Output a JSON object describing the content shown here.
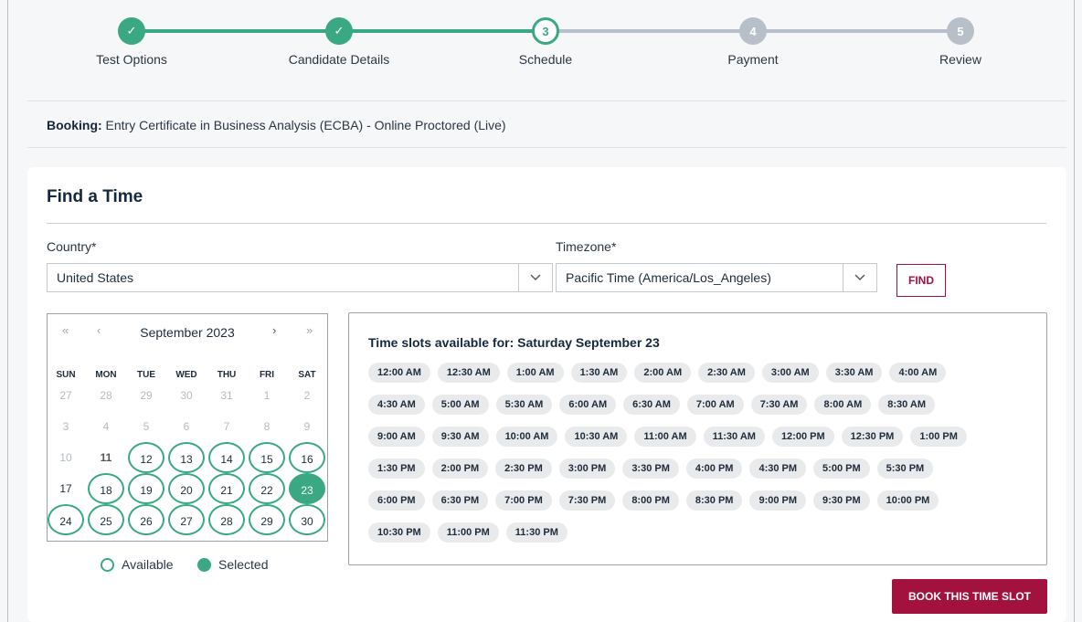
{
  "steps": [
    {
      "label": "Test Options",
      "state": "done",
      "mark": "✓"
    },
    {
      "label": "Candidate Details",
      "state": "done",
      "mark": "✓"
    },
    {
      "label": "Schedule",
      "state": "current",
      "mark": "3"
    },
    {
      "label": "Payment",
      "state": "todo",
      "mark": "4"
    },
    {
      "label": "Review",
      "state": "todo",
      "mark": "5"
    }
  ],
  "booking": {
    "prefix": "Booking:",
    "text": " Entry Certificate in Business Analysis (ECBA) - Online Proctored (Live)"
  },
  "card": {
    "title": "Find a Time"
  },
  "country": {
    "label": "Country*",
    "value": "United States"
  },
  "timezone": {
    "label": "Timezone*",
    "value": "Pacific Time (America/Los_Angeles)"
  },
  "find_label": "FIND",
  "calendar": {
    "month": "September 2023",
    "nav": {
      "prev_year": "«",
      "prev": "‹",
      "next": "›",
      "next_year": "»"
    },
    "dows": [
      "SUN",
      "MON",
      "TUE",
      "WED",
      "THU",
      "FRI",
      "SAT"
    ],
    "weeks": [
      [
        {
          "d": "27",
          "s": "muted"
        },
        {
          "d": "28",
          "s": "muted"
        },
        {
          "d": "29",
          "s": "muted"
        },
        {
          "d": "30",
          "s": "muted"
        },
        {
          "d": "31",
          "s": "muted"
        },
        {
          "d": "1",
          "s": "muted"
        },
        {
          "d": "2",
          "s": "muted"
        }
      ],
      [
        {
          "d": "3",
          "s": "muted"
        },
        {
          "d": "4",
          "s": "muted"
        },
        {
          "d": "5",
          "s": "muted"
        },
        {
          "d": "6",
          "s": "muted"
        },
        {
          "d": "7",
          "s": "muted"
        },
        {
          "d": "8",
          "s": "muted"
        },
        {
          "d": "9",
          "s": "muted"
        }
      ],
      [
        {
          "d": "10",
          "s": "muted"
        },
        {
          "d": "11",
          "s": "bold"
        },
        {
          "d": "12",
          "s": "avail"
        },
        {
          "d": "13",
          "s": "avail"
        },
        {
          "d": "14",
          "s": "avail"
        },
        {
          "d": "15",
          "s": "avail"
        },
        {
          "d": "16",
          "s": "avail"
        }
      ],
      [
        {
          "d": "17",
          "s": "plain"
        },
        {
          "d": "18",
          "s": "avail"
        },
        {
          "d": "19",
          "s": "avail"
        },
        {
          "d": "20",
          "s": "avail"
        },
        {
          "d": "21",
          "s": "avail"
        },
        {
          "d": "22",
          "s": "avail"
        },
        {
          "d": "23",
          "s": "sel"
        }
      ],
      [
        {
          "d": "24",
          "s": "avail"
        },
        {
          "d": "25",
          "s": "avail"
        },
        {
          "d": "26",
          "s": "avail"
        },
        {
          "d": "27",
          "s": "avail"
        },
        {
          "d": "28",
          "s": "avail"
        },
        {
          "d": "29",
          "s": "avail"
        },
        {
          "d": "30",
          "s": "avail"
        }
      ]
    ],
    "legend": {
      "available": "Available",
      "selected": "Selected"
    }
  },
  "slots": {
    "title": "Time slots available for: Saturday September 23",
    "rows": [
      [
        "12:00 AM",
        "12:30 AM",
        "1:00 AM",
        "1:30 AM",
        "2:00 AM",
        "2:30 AM",
        "3:00 AM",
        "3:30 AM",
        "4:00 AM"
      ],
      [
        "4:30 AM",
        "5:00 AM",
        "5:30 AM",
        "6:00 AM",
        "6:30 AM",
        "7:00 AM",
        "7:30 AM",
        "8:00 AM",
        "8:30 AM"
      ],
      [
        "9:00 AM",
        "9:30 AM",
        "10:00 AM",
        "10:30 AM",
        "11:00 AM",
        "11:30 AM",
        "12:00 PM",
        "12:30 PM",
        "1:00 PM"
      ],
      [
        "1:30 PM",
        "2:00 PM",
        "2:30 PM",
        "3:00 PM",
        "3:30 PM",
        "4:00 PM",
        "4:30 PM",
        "5:00 PM",
        "5:30 PM"
      ],
      [
        "6:00 PM",
        "6:30 PM",
        "7:00 PM",
        "7:30 PM",
        "8:00 PM",
        "8:30 PM",
        "9:00 PM",
        "9:30 PM",
        "10:00 PM"
      ],
      [
        "10:30 PM",
        "11:00 PM",
        "11:30 PM"
      ]
    ]
  },
  "book_label": "BOOK THIS TIME SLOT",
  "colors": {
    "accent_green": "#3aa882",
    "brand_maroon": "#a3123f",
    "pending_gray": "#b7c0c9"
  }
}
